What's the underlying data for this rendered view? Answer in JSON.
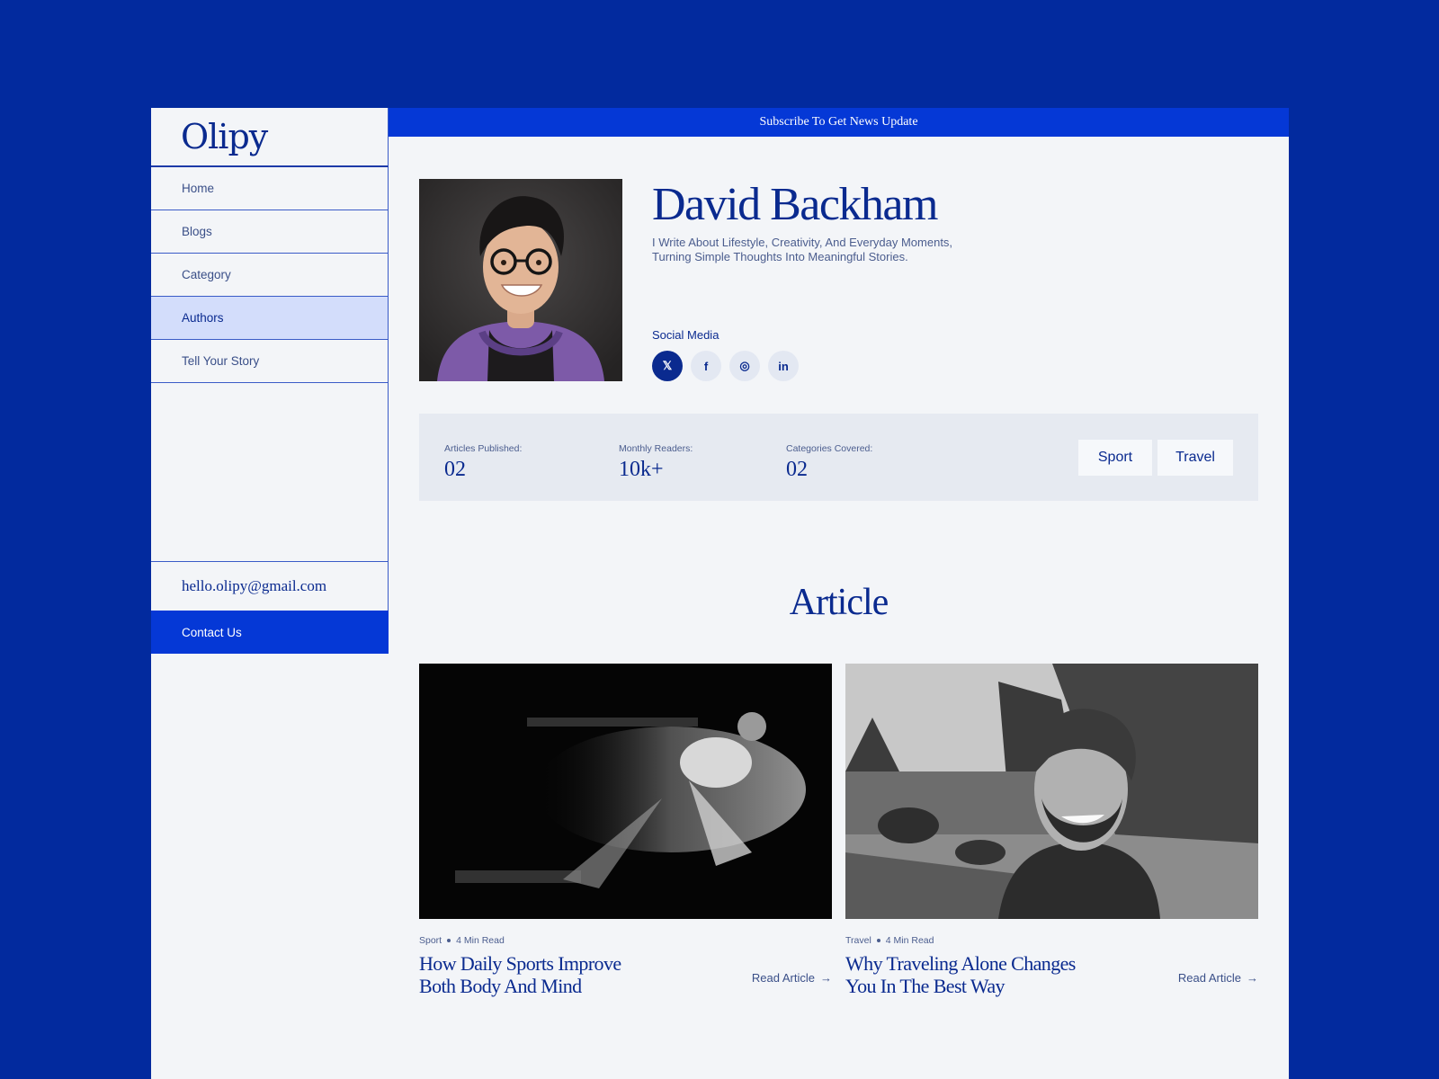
{
  "brand": {
    "logo": "Olipy"
  },
  "sidebar": {
    "items": [
      {
        "label": "Home"
      },
      {
        "label": "Blogs"
      },
      {
        "label": "Category"
      },
      {
        "label": "Authors"
      },
      {
        "label": "Tell Your Story"
      }
    ],
    "active_item": "Authors",
    "email": "hello.olipy@gmail.com",
    "contact_label": "Contact Us"
  },
  "banner": {
    "text": "Subscribe To Get News Update"
  },
  "author": {
    "name": "David Backham",
    "bio": "I Write About Lifestyle, Creativity, And Everyday Moments, Turning Simple Thoughts Into Meaningful Stories.",
    "social_label": "Social Media",
    "social": [
      {
        "icon": "x-icon",
        "glyph": "𝕏"
      },
      {
        "icon": "facebook-icon",
        "glyph": "f"
      },
      {
        "icon": "instagram-icon",
        "glyph": "◎"
      },
      {
        "icon": "linkedin-icon",
        "glyph": "in"
      }
    ]
  },
  "stats": [
    {
      "label": "Articles Published:",
      "value": "02"
    },
    {
      "label": "Monthly Readers:",
      "value": "10k+"
    },
    {
      "label": "Categories Covered:",
      "value": "02"
    }
  ],
  "tags": [
    "Sport",
    "Travel"
  ],
  "articles_section": {
    "title": "Article"
  },
  "articles": [
    {
      "category": "Sport",
      "read_time": "4 Min Read",
      "title": "How Daily Sports Improve Both Body And Mind",
      "link": "Read Article"
    },
    {
      "category": "Travel",
      "read_time": "4 Min Read",
      "title": "Why Traveling Alone Changes You In The Best Way",
      "link": "Read Article"
    }
  ],
  "colors": {
    "primary": "#0538d6",
    "navy": "#0a2a8f",
    "background": "#022a9e",
    "active_nav": "#d3ddfb"
  }
}
